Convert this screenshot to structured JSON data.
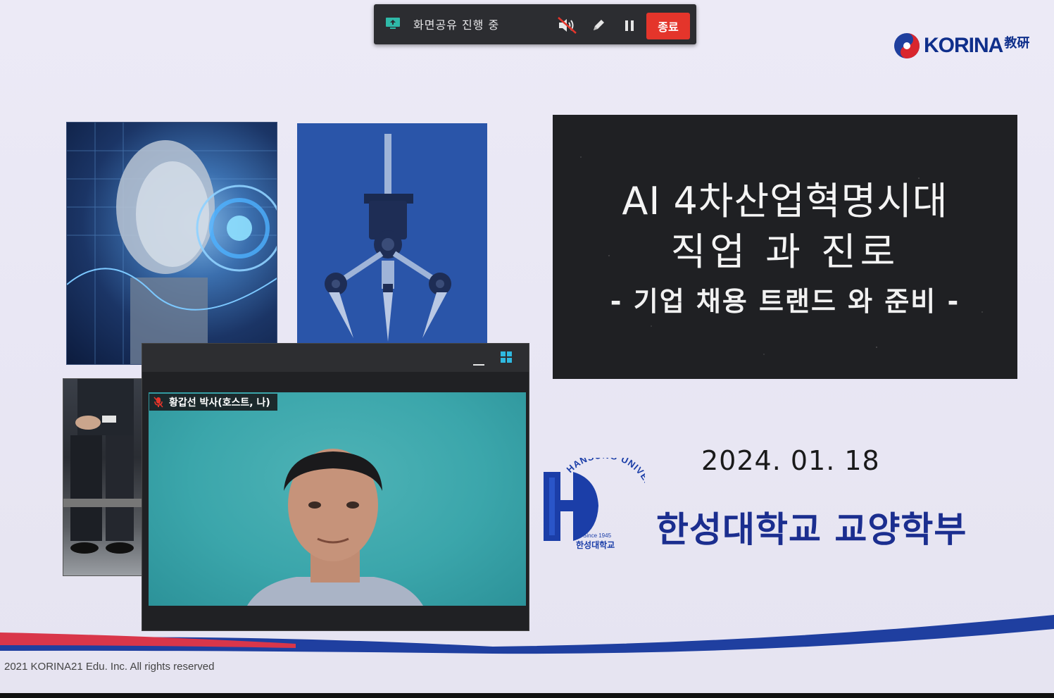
{
  "toolbar": {
    "share_status": "화면공유 진행 중",
    "end_label": "종료",
    "colors": {
      "background": "#2c2d31",
      "end_button": "#e4352b"
    }
  },
  "slide": {
    "logo": {
      "text": "KORINA",
      "sub": "教硏"
    },
    "title_line1": "AI 4차산업혁명시대",
    "title_line2": "직업 과 진로",
    "subtitle": "- 기업 채용 트랜드 와 준비 -",
    "date": "2024. 01. 18",
    "university": "한성대학교 교양학부",
    "univ_logo": {
      "top_text": "HANSUNG UNIVERSITY",
      "since": "Since 1945",
      "korean": "한성대학교",
      "color": "#1b3ea8"
    },
    "copyright": "2021 KORINA21 Edu. Inc. All rights reserved"
  },
  "video": {
    "participant_name": "황갑선 박사(호스트, 나)",
    "mic_state": "muted",
    "background_color": "#3ba6ab"
  }
}
